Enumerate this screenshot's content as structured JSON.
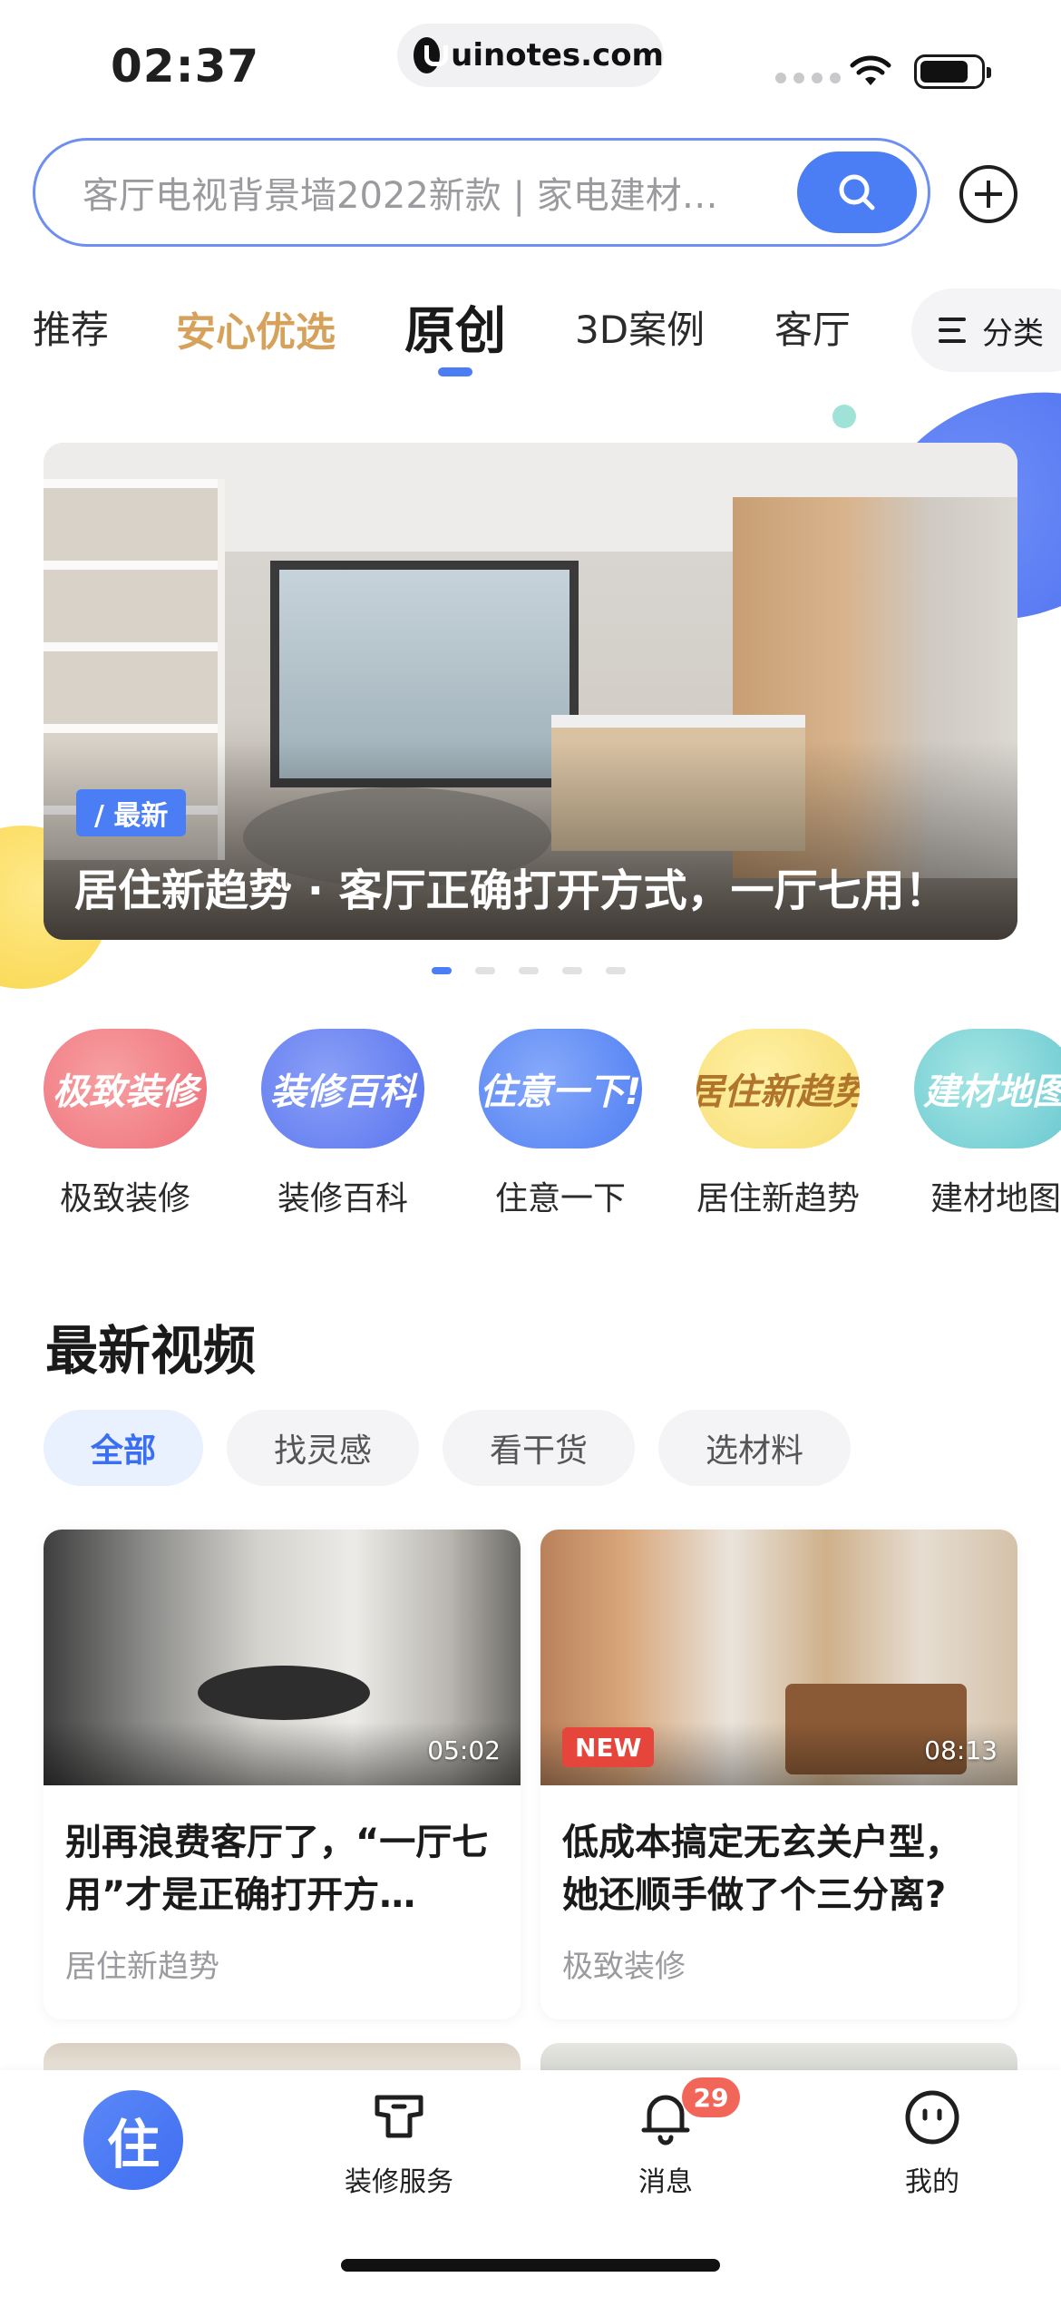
{
  "status_bar": {
    "time": "02:37",
    "url": "uinotes.com"
  },
  "search": {
    "placeholder": "客厅电视背景墙2022新款 | 家电建材…"
  },
  "tabs": [
    {
      "label": "推荐"
    },
    {
      "label": "安心优选"
    },
    {
      "label": "原创"
    },
    {
      "label": "3D案例"
    },
    {
      "label": "客厅"
    }
  ],
  "active_tab": "原创",
  "category_button": {
    "label": "分类"
  },
  "banner": {
    "tag": "/ 最新",
    "title": "居住新趋势 · 客厅正确打开方式，一厅七用！",
    "slide_count": 5,
    "active_slide": 1
  },
  "shortcuts": [
    {
      "label": "极致装修",
      "art_text": "极致装修",
      "color": "#f07f86"
    },
    {
      "label": "装修百科",
      "art_text": "装修百科",
      "color": "#5f7cf0"
    },
    {
      "label": "住意一下",
      "art_text": "住意一下!",
      "color": "#5b86f3"
    },
    {
      "label": "居住新趋势",
      "art_text": "居住新趋势",
      "color": "#f8e38a"
    },
    {
      "label": "建材地图",
      "art_text": "建材地图",
      "color": "#7ed3d6"
    }
  ],
  "section": {
    "title": "最新视频",
    "filters": [
      "全部",
      "找灵感",
      "看干货",
      "选材料"
    ],
    "active_filter": "全部"
  },
  "videos": [
    {
      "title": "别再浪费客厅了，“一厅七用”才是正确打开方…",
      "source": "居住新趋势",
      "duration": "05:02",
      "badge": ""
    },
    {
      "title": "低成本搞定无玄关户型，她还顺手做了个三分离?",
      "source": "极致装修",
      "duration": "08:13",
      "badge": "NEW"
    }
  ],
  "bottom_nav": {
    "home_glyph": "住",
    "service_label": "装修服务",
    "messages_label": "消息",
    "messages_badge": "29",
    "me_label": "我的"
  },
  "colors": {
    "accent": "#4b7df4",
    "featured": "#d6a25b",
    "badge": "#f2665a"
  }
}
